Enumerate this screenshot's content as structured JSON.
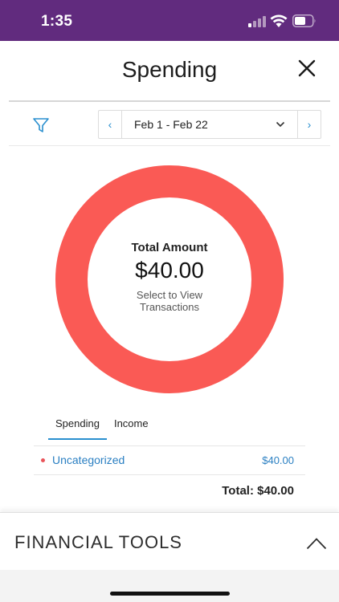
{
  "status_bar": {
    "time": "1:35"
  },
  "header": {
    "title": "Spending"
  },
  "date_range": {
    "label": "Feb 1 - Feb 22"
  },
  "summary": {
    "label": "Total Amount",
    "amount": "$40.00",
    "hint_line1": "Select to View",
    "hint_line2": "Transactions"
  },
  "chart_data": {
    "type": "pie",
    "categories": [
      "Uncategorized"
    ],
    "values": [
      40.0
    ],
    "colors": [
      "#fa5a55"
    ]
  },
  "tabs": [
    {
      "label": "Spending",
      "active": true
    },
    {
      "label": "Income",
      "active": false
    }
  ],
  "categories": [
    {
      "label": "Uncategorized",
      "amount": "$40.00",
      "color": "#e9545a"
    }
  ],
  "total": "Total: $40.00",
  "financial_tools": {
    "title": "FINANCIAL TOOLS"
  },
  "colors": {
    "status_bar": "#612b7e",
    "accent": "#2a8fcf",
    "donut": "#fa5a55"
  }
}
